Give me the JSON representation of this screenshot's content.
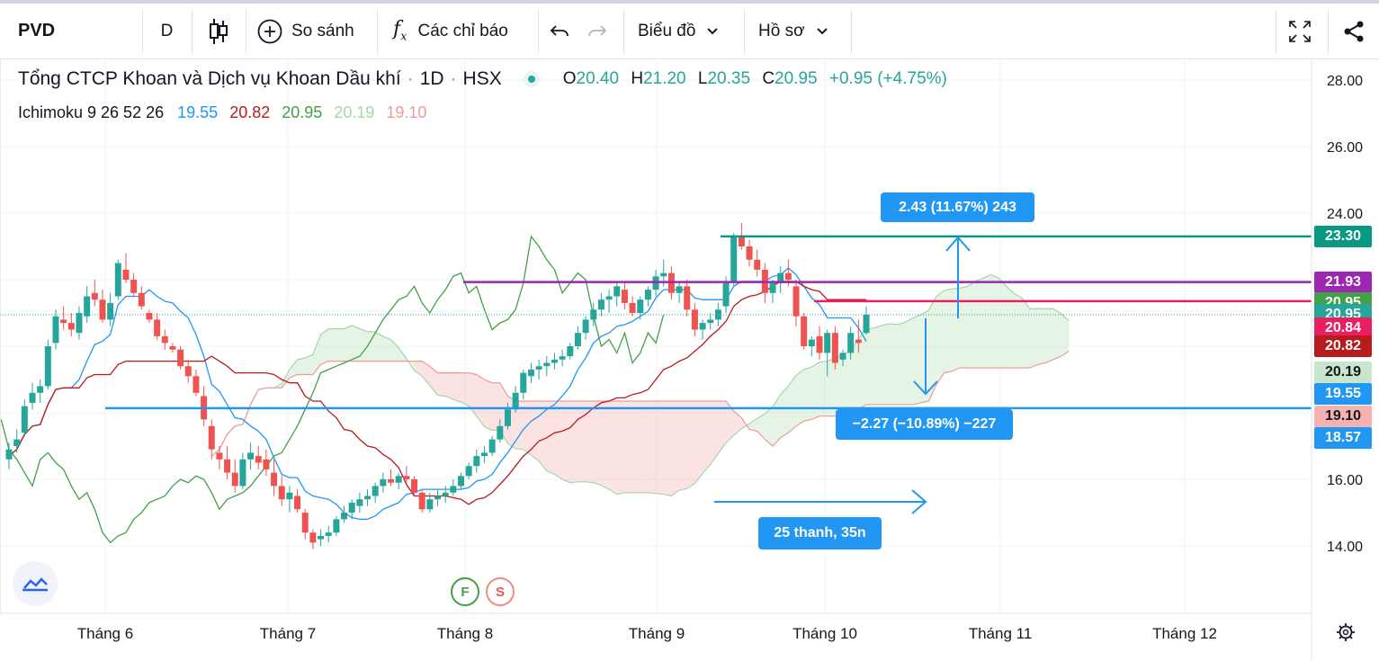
{
  "toolbar": {
    "symbol": "PVD",
    "interval": "D",
    "compare_label": "So sánh",
    "indicators_label": "Các chỉ báo",
    "chart_menu_label": "Biểu đồ",
    "profile_label": "Hồ sơ"
  },
  "legend": {
    "name": "Tổng CTCP Khoan và Dịch vụ Khoan Dầu khí",
    "interval": "1D",
    "exchange": "HSX",
    "o_label": "O",
    "o_value": "20.40",
    "h_label": "H",
    "h_value": "21.20",
    "l_label": "L",
    "l_value": "20.35",
    "c_label": "C",
    "c_value": "20.95",
    "change": "+0.95 (+4.75%)",
    "indicator": "Ichimoku 9 26 52 26",
    "ind_values": [
      "19.55",
      "20.82",
      "20.95",
      "20.19",
      "19.10"
    ]
  },
  "colors": {
    "up": "#26a69a",
    "down": "#ef5350",
    "tenkan": "#2196f3",
    "kijun": "#b71c1c",
    "chikou": "#43a047",
    "span_a": "#a5d6a7",
    "span_b": "#ef9a9a",
    "teal_line": "#089981",
    "purple_line": "#9c27b0",
    "magenta_line": "#e91e63",
    "blue_line": "#2196f3"
  },
  "axis_tags": [
    {
      "text": "23.30",
      "color": "#089981",
      "value": 23.3
    },
    {
      "text": "21.93",
      "color": "#9c27b0",
      "value": 21.93
    },
    {
      "text": "20.95",
      "color": "#43a047",
      "value": 21.3
    },
    {
      "text": "20.95",
      "color": "#26a69a",
      "value": 20.95
    },
    {
      "text": "20.84",
      "color": "#e91e63",
      "value": 20.55
    },
    {
      "text": "20.82",
      "color": "#b71c1c",
      "value": 20.0
    },
    {
      "text": "20.19",
      "color": "#c8e6c9",
      "value": 19.22,
      "dark": true
    },
    {
      "text": "19.55",
      "color": "#2196f3",
      "value": 18.57
    },
    {
      "text": "19.10",
      "color": "#f6b1b1",
      "value": 17.9,
      "dark": true
    },
    {
      "text": "18.57",
      "color": "#2196f3",
      "value": 17.25
    }
  ],
  "measure": {
    "up_label": "2.43 (11.67%) 243",
    "down_label": "−2.27 (−10.89%) −227",
    "range_label": "25 thanh, 35n"
  },
  "marks": {
    "f": "F",
    "s": "S"
  },
  "chart_data": {
    "type": "candlestick",
    "y_ticks": [
      28,
      26,
      24,
      16,
      14
    ],
    "y_tick_labels": [
      "28.00",
      "26.00",
      "24.00",
      "16.00",
      "14.00"
    ],
    "x_labels": [
      "Tháng 6",
      "Tháng 7",
      "Tháng 8",
      "Tháng 9",
      "Tháng 10",
      "Tháng 11",
      "Tháng 12"
    ],
    "candles": [
      [
        16.6,
        17.1,
        16.3,
        16.9
      ],
      [
        17.0,
        17.5,
        16.8,
        17.2
      ],
      [
        17.4,
        18.4,
        17.3,
        18.2
      ],
      [
        18.3,
        18.9,
        18.1,
        18.6
      ],
      [
        18.6,
        19.0,
        18.3,
        18.8
      ],
      [
        18.8,
        20.2,
        18.7,
        20.0
      ],
      [
        20.1,
        21.1,
        19.9,
        20.9
      ],
      [
        20.8,
        21.2,
        20.5,
        20.7
      ],
      [
        20.7,
        21.0,
        20.3,
        20.5
      ],
      [
        20.4,
        21.2,
        20.2,
        21.0
      ],
      [
        20.9,
        21.8,
        20.7,
        21.5
      ],
      [
        21.6,
        22.0,
        21.2,
        21.4
      ],
      [
        21.4,
        21.7,
        20.7,
        20.8
      ],
      [
        20.8,
        21.6,
        20.6,
        21.3
      ],
      [
        21.5,
        22.6,
        21.4,
        22.5
      ],
      [
        22.3,
        22.8,
        21.9,
        22.0
      ],
      [
        22.0,
        22.2,
        21.5,
        21.6
      ],
      [
        21.6,
        21.8,
        21.1,
        21.2
      ],
      [
        21.0,
        21.1,
        20.7,
        20.8
      ],
      [
        20.8,
        21.0,
        20.2,
        20.3
      ],
      [
        20.3,
        20.5,
        19.9,
        20.1
      ],
      [
        20.0,
        20.1,
        19.8,
        19.9
      ],
      [
        19.9,
        20.0,
        19.3,
        19.4
      ],
      [
        19.4,
        19.6,
        18.9,
        19.1
      ],
      [
        19.1,
        19.3,
        18.5,
        18.6
      ],
      [
        18.5,
        18.8,
        17.6,
        17.8
      ],
      [
        17.6,
        17.8,
        16.6,
        16.9
      ],
      [
        16.8,
        17.0,
        16.3,
        16.6
      ],
      [
        16.6,
        17.0,
        16.0,
        16.2
      ],
      [
        16.2,
        16.6,
        15.6,
        15.8
      ],
      [
        15.8,
        16.8,
        15.7,
        16.6
      ],
      [
        16.6,
        17.1,
        16.3,
        16.8
      ],
      [
        16.7,
        17.0,
        16.3,
        16.5
      ],
      [
        16.6,
        16.9,
        16.1,
        16.3
      ],
      [
        16.2,
        16.6,
        15.5,
        15.8
      ],
      [
        15.8,
        16.1,
        15.2,
        15.4
      ],
      [
        15.4,
        15.8,
        15.0,
        15.6
      ],
      [
        15.5,
        15.7,
        15.0,
        15.1
      ],
      [
        15.0,
        15.1,
        14.2,
        14.4
      ],
      [
        14.4,
        14.5,
        13.9,
        14.1
      ],
      [
        14.2,
        14.5,
        14.0,
        14.3
      ],
      [
        14.3,
        14.6,
        14.1,
        14.4
      ],
      [
        14.4,
        14.9,
        14.3,
        14.8
      ],
      [
        14.8,
        15.2,
        14.7,
        15.0
      ],
      [
        15.0,
        15.4,
        14.8,
        15.3
      ],
      [
        15.2,
        15.6,
        15.0,
        15.4
      ],
      [
        15.4,
        15.7,
        15.2,
        15.5
      ],
      [
        15.5,
        15.9,
        15.3,
        15.8
      ],
      [
        15.8,
        16.2,
        15.6,
        16.0
      ],
      [
        16.0,
        16.3,
        15.8,
        15.9
      ],
      [
        15.9,
        16.2,
        15.7,
        16.1
      ],
      [
        16.1,
        16.4,
        15.9,
        16.0
      ],
      [
        16.0,
        16.1,
        15.5,
        15.6
      ],
      [
        15.6,
        15.7,
        15.0,
        15.1
      ],
      [
        15.1,
        15.6,
        15.0,
        15.4
      ],
      [
        15.4,
        15.7,
        15.2,
        15.5
      ],
      [
        15.5,
        15.8,
        15.3,
        15.6
      ],
      [
        15.6,
        16.0,
        15.5,
        15.8
      ],
      [
        15.8,
        16.2,
        15.7,
        16.1
      ],
      [
        16.1,
        16.5,
        16.0,
        16.4
      ],
      [
        16.4,
        16.9,
        16.2,
        16.7
      ],
      [
        16.7,
        17.0,
        16.5,
        16.8
      ],
      [
        16.8,
        17.3,
        16.7,
        17.2
      ],
      [
        17.2,
        17.8,
        17.1,
        17.6
      ],
      [
        17.6,
        18.3,
        17.5,
        18.1
      ],
      [
        18.1,
        18.8,
        18.0,
        18.6
      ],
      [
        18.6,
        19.3,
        18.4,
        19.2
      ],
      [
        19.1,
        19.5,
        18.9,
        19.3
      ],
      [
        19.3,
        19.6,
        19.0,
        19.4
      ],
      [
        19.4,
        19.7,
        19.1,
        19.5
      ],
      [
        19.5,
        19.8,
        19.3,
        19.6
      ],
      [
        19.6,
        19.9,
        19.4,
        19.7
      ],
      [
        19.7,
        20.1,
        19.6,
        20.0
      ],
      [
        20.0,
        20.6,
        19.9,
        20.4
      ],
      [
        20.4,
        20.9,
        20.2,
        20.8
      ],
      [
        20.8,
        21.3,
        20.6,
        21.1
      ],
      [
        21.1,
        21.6,
        20.9,
        21.4
      ],
      [
        21.4,
        21.7,
        21.0,
        21.5
      ],
      [
        21.5,
        21.9,
        21.2,
        21.8
      ],
      [
        21.7,
        21.9,
        21.1,
        21.3
      ],
      [
        21.3,
        21.5,
        20.9,
        21.0
      ],
      [
        21.0,
        21.5,
        20.8,
        21.4
      ],
      [
        21.4,
        21.8,
        21.2,
        21.7
      ],
      [
        21.7,
        22.3,
        21.5,
        22.1
      ],
      [
        22.1,
        22.6,
        21.8,
        22.2
      ],
      [
        22.2,
        22.4,
        21.4,
        21.6
      ],
      [
        21.6,
        21.9,
        21.3,
        21.8
      ],
      [
        21.8,
        22.0,
        20.9,
        21.1
      ],
      [
        21.1,
        21.3,
        20.3,
        20.5
      ],
      [
        20.5,
        20.8,
        20.2,
        20.7
      ],
      [
        20.7,
        21.0,
        20.5,
        20.8
      ],
      [
        20.8,
        21.3,
        20.6,
        21.1
      ],
      [
        21.2,
        22.1,
        21.0,
        21.9
      ],
      [
        21.9,
        23.4,
        21.8,
        23.3
      ],
      [
        23.3,
        23.7,
        22.9,
        23.0
      ],
      [
        23.0,
        23.2,
        22.4,
        22.6
      ],
      [
        22.6,
        22.9,
        22.1,
        22.3
      ],
      [
        22.3,
        22.5,
        21.3,
        21.6
      ],
      [
        21.6,
        22.0,
        21.3,
        21.9
      ],
      [
        21.9,
        22.4,
        21.6,
        22.2
      ],
      [
        22.2,
        22.6,
        21.8,
        22.0
      ],
      [
        21.8,
        22.0,
        20.6,
        20.9
      ],
      [
        20.9,
        21.0,
        19.9,
        20.0
      ],
      [
        20.0,
        20.3,
        19.7,
        20.2
      ],
      [
        20.3,
        20.6,
        19.6,
        19.8
      ],
      [
        19.8,
        20.5,
        19.1,
        20.4
      ],
      [
        20.4,
        20.6,
        19.3,
        19.5
      ],
      [
        19.6,
        19.9,
        19.4,
        19.8
      ],
      [
        19.8,
        20.6,
        19.6,
        20.4
      ],
      [
        20.2,
        20.8,
        19.8,
        20.1
      ],
      [
        20.4,
        21.2,
        20.35,
        20.95
      ]
    ],
    "price_lines": [
      {
        "value": 23.3,
        "color": "#089981",
        "label": "23.30"
      },
      {
        "value": 21.93,
        "color": "#9c27b0",
        "label": "21.93"
      },
      {
        "value": 20.84,
        "color": "#e91e63",
        "label": "20.84"
      },
      {
        "value": 18.57,
        "color": "#2196f3",
        "label": "18.57"
      }
    ]
  }
}
